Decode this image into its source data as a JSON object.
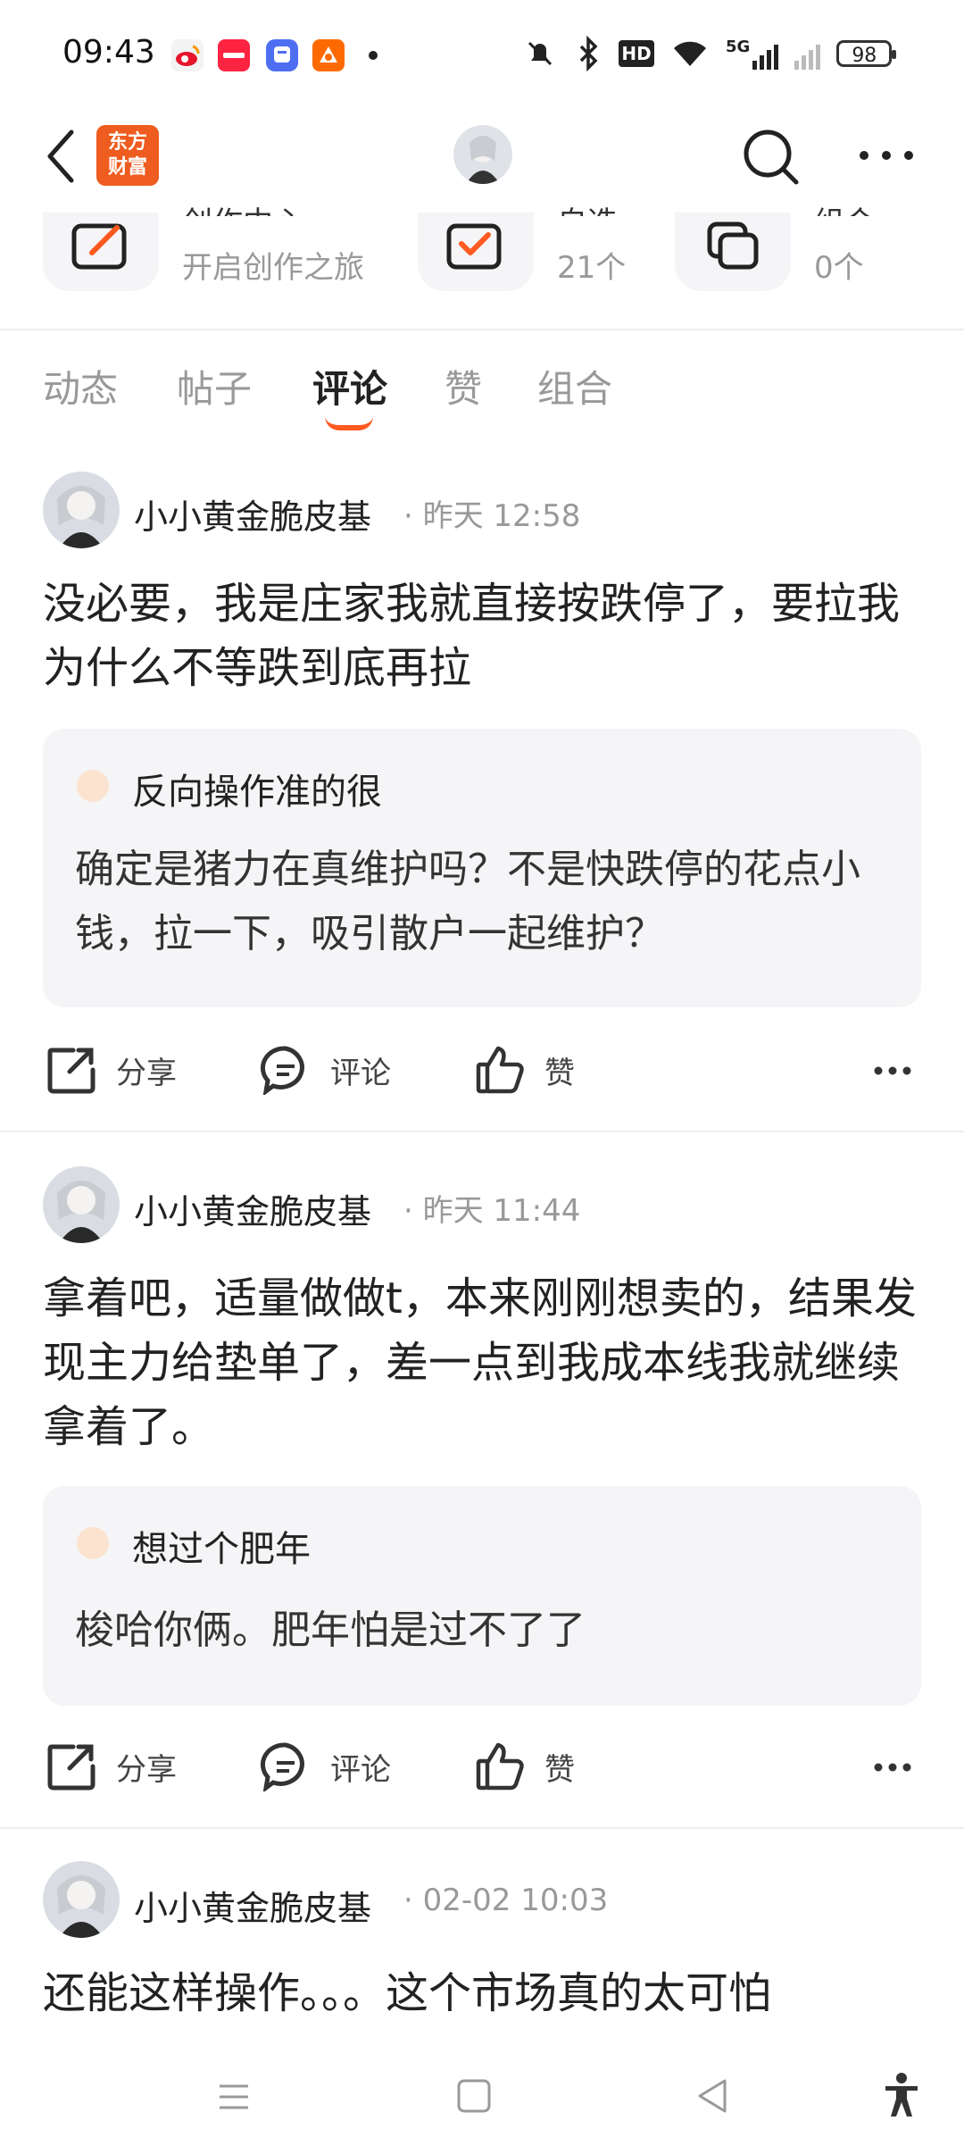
{
  "status_bar": {
    "time": "09:43",
    "app_icons": [
      {
        "name": "weibo-icon",
        "color": "#e6162d"
      },
      {
        "name": "xiaohongshu-icon",
        "color": "#ff2442"
      },
      {
        "name": "tieba-icon",
        "color": "#4e6ef2"
      },
      {
        "name": "taobao-icon",
        "color": "#ff6a00"
      }
    ],
    "hd_label": "HD",
    "network_label": "5G",
    "battery": "98"
  },
  "header": {
    "logo_text": "东方财富",
    "icons": [
      "back-icon",
      "search-icon",
      "more-icon"
    ]
  },
  "quick_cards": [
    {
      "title": "创作中心",
      "subtitle": "开启创作之旅"
    },
    {
      "title": "自选",
      "subtitle": "21个"
    },
    {
      "title": "组合",
      "subtitle": "0个"
    }
  ],
  "tabs": [
    {
      "label": "动态",
      "active": false
    },
    {
      "label": "帖子",
      "active": false
    },
    {
      "label": "评论",
      "active": true
    },
    {
      "label": "赞",
      "active": false
    },
    {
      "label": "组合",
      "active": false
    }
  ],
  "posts": [
    {
      "username": "小小黄金脆皮基",
      "time": "· 昨天 12:58",
      "text": "没必要，我是庄家我就直接按跌停了，要拉我为什么不等跌到底再拉",
      "quote": {
        "username": "反向操作准的很",
        "text": "确定是猪力在真维护吗？不是快跌停的花点小钱，拉一下，吸引散户一起维护？"
      }
    },
    {
      "username": "小小黄金脆皮基",
      "time": "· 昨天 11:44",
      "text": "拿着吧，适量做做t，本来刚刚想卖的，结果发现主力给垫单了，差一点到我成本线我就继续拿着了。",
      "quote": {
        "username": "想过个肥年",
        "text": "梭哈你俩。肥年怕是过不了了"
      }
    },
    {
      "username": "小小黄金脆皮基",
      "time": "· 02-02 10:03",
      "text": "还能这样操作。。。这个市场真的太可怕"
    }
  ],
  "actions": {
    "share": "分享",
    "comment": "评论",
    "like": "赞"
  },
  "accent_color": "#ff5a1f"
}
